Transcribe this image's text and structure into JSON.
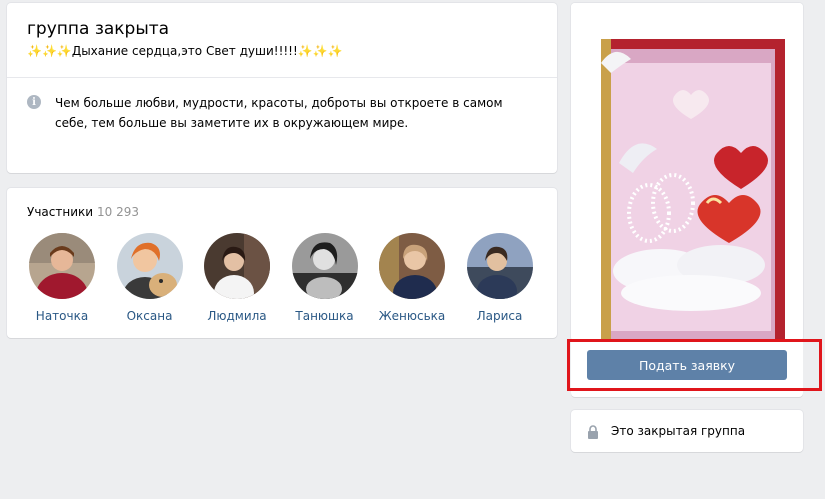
{
  "group": {
    "title": "группа закрыта",
    "status_prefix": "✨✨✨",
    "status_text": "Дыхание сердца,это Свет души!!!!!",
    "status_suffix": "✨✨✨",
    "description": "Чем больше любви, мудрости, красоты, доброты вы откроете в самом себе, тем больше вы заметите их в окружающем мире."
  },
  "members": {
    "title": "Участники",
    "count": "10 293",
    "list": [
      {
        "name": "Наточка",
        "colors": [
          "#8a1a2a",
          "#c8a98a"
        ]
      },
      {
        "name": "Оксана",
        "colors": [
          "#e07a2e",
          "#f2c8a0"
        ]
      },
      {
        "name": "Людмила",
        "colors": [
          "#5a4236",
          "#e8e4e0"
        ]
      },
      {
        "name": "Танюшка",
        "colors": [
          "#2a2a2a",
          "#cfcfcf"
        ]
      },
      {
        "name": "Женюська",
        "colors": [
          "#7a5a45",
          "#c9b49a"
        ]
      },
      {
        "name": "Лариса",
        "colors": [
          "#3c4a6a",
          "#d8c0a8"
        ]
      }
    ]
  },
  "actions": {
    "join_label": "Подать заявку"
  },
  "closed": {
    "label": "Это закрытая группа"
  },
  "colors": {
    "link": "#2a5885",
    "button": "#5e81a8",
    "highlight": "#e0151b"
  }
}
